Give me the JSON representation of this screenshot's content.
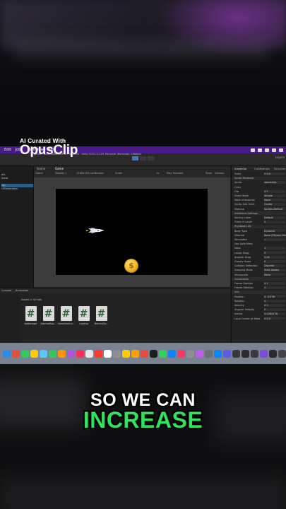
{
  "watermark": {
    "line1": "AI Curated With",
    "line2": "OpusClip"
  },
  "menubar": {
    "items": [
      "Edit",
      "Jobs",
      "Window",
      "Help"
    ],
    "title": "game - BAM-GAMES-APPS - Android - Unity 2021.3.11f1 Personal (Personal) <Metal>"
  },
  "toolbar": {
    "layers": "Layers"
  },
  "hierarchy": {
    "rows": [
      "ple",
      "mera",
      "",
      "hip",
      "ckGeneration"
    ]
  },
  "scene": {
    "tab_scene": "Scene",
    "tab_game": "Game",
    "game_label": "Game",
    "display": "Display 1",
    "resolution": "1280x720 Landscape",
    "scale": "Scale",
    "scale_val": "1x",
    "play_focused": "Play Focused",
    "stats": "Stats",
    "gizmos": "Gizmos"
  },
  "coin": {
    "symbol": "$"
  },
  "inspector": {
    "tabs": [
      "Inspector",
      "Collaborate",
      "Services"
    ],
    "rows": [
      {
        "k": "Scale",
        "v": "X 0.5"
      },
      {
        "k": "Sprite Renderer",
        "v": ""
      },
      {
        "k": "Sprite",
        "v": "spaceship"
      },
      {
        "k": "Color",
        "v": ""
      },
      {
        "k": "Flip",
        "v": "X  Y"
      },
      {
        "k": "Draw Mode",
        "v": "Simple"
      },
      {
        "k": "Mask Interaction",
        "v": "None"
      },
      {
        "k": "Sprite Sort Point",
        "v": "Center"
      },
      {
        "k": "Material",
        "v": "Sprites-Default"
      },
      {
        "k": "Additional Settings",
        "v": ""
      },
      {
        "k": "Sorting Layer",
        "v": "Default"
      },
      {
        "k": "Order in Layer",
        "v": "0"
      },
      {
        "k": "Rigidbody 2D",
        "v": ""
      },
      {
        "k": "Body Type",
        "v": "Dynamic"
      },
      {
        "k": "Material",
        "v": "None (Physics Mat)"
      },
      {
        "k": "Simulated",
        "v": "✓"
      },
      {
        "k": "Use Auto Mass",
        "v": ""
      },
      {
        "k": "Mass",
        "v": "1"
      },
      {
        "k": "Linear Drag",
        "v": "0"
      },
      {
        "k": "Angular Drag",
        "v": "0.05"
      },
      {
        "k": "Gravity Scale",
        "v": "0"
      },
      {
        "k": "Collision Detection",
        "v": "Discrete"
      },
      {
        "k": "Sleeping Mode",
        "v": "Start Awake"
      },
      {
        "k": "Interpolate",
        "v": "None"
      },
      {
        "k": "Constraints",
        "v": ""
      },
      {
        "k": "Freeze Position",
        "v": "X  Y"
      },
      {
        "k": "Freeze Rotation",
        "v": "Z"
      },
      {
        "k": "Info",
        "v": ""
      },
      {
        "k": "Position",
        "v": "X -4.336"
      },
      {
        "k": "Rotation",
        "v": "0"
      },
      {
        "k": "Velocity",
        "v": "X 0"
      },
      {
        "k": "Angular Velocity",
        "v": "0"
      },
      {
        "k": "Inertia",
        "v": "0.0264178"
      },
      {
        "k": "Local Center of Mass",
        "v": "X 0.0"
      }
    ]
  },
  "project": {
    "tabs": [
      "Console",
      "Animation"
    ],
    "breadcrumb": "Assets > Scripts",
    "files": [
      "AdManager",
      "AsteroidSpa...",
      "GameControl...",
      "Loading",
      "MetricsSto..."
    ],
    "file_glyph": "#"
  },
  "dock": {
    "icon_colors": [
      "#2f8be6",
      "#e94b3c",
      "#34c759",
      "#ffcc00",
      "#5ac8fa",
      "#34c759",
      "#ff9500",
      "#af52de",
      "#ff2d55",
      "#e5e5ea",
      "#ff3b30",
      "#ffffff",
      "#8e8e93",
      "#ffcc00",
      "#ff9f0a",
      "#e94b3c",
      "#1d1d1f",
      "#30d158",
      "#0a84ff",
      "#ff375f",
      "#8e8e93",
      "#bf5af2",
      "#6e6e73",
      "#0a84ff",
      "#5e5ce6",
      "#3a3a3c",
      "#2c2c2e",
      "#3a3a3c",
      "#7d4cdb",
      "#2c2c2e",
      "#444"
    ]
  },
  "caption": {
    "line1": "SO WE CAN",
    "line2": "INCREASE"
  }
}
